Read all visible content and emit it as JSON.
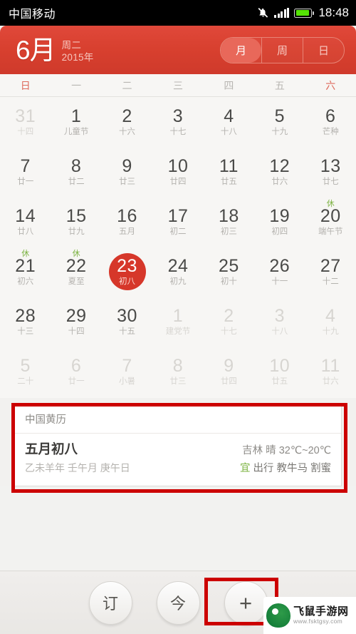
{
  "statusbar": {
    "carrier": "中国移动",
    "mute_icon": "mute-bell-icon",
    "signal_icon": "signal-bars-icon",
    "battery_icon": "battery-icon",
    "clock": "18:48"
  },
  "header": {
    "month": "6月",
    "weekday": "周二",
    "year": "2015年",
    "accent": "#d8402f",
    "segments": [
      {
        "label": "月",
        "selected": true
      },
      {
        "label": "周",
        "selected": false
      },
      {
        "label": "日",
        "selected": false
      }
    ]
  },
  "weekdays": [
    {
      "label": "日",
      "weekend": true
    },
    {
      "label": "一",
      "weekend": false
    },
    {
      "label": "二",
      "weekend": false
    },
    {
      "label": "三",
      "weekend": false
    },
    {
      "label": "四",
      "weekend": false
    },
    {
      "label": "五",
      "weekend": false
    },
    {
      "label": "六",
      "weekend": true
    }
  ],
  "calendar": {
    "today_color": "#d6372a",
    "rest_badge_color": "#7cb342",
    "rows": [
      [
        {
          "day": "31",
          "lunar": "十四",
          "dim": true,
          "badge": "",
          "today": false
        },
        {
          "day": "1",
          "lunar": "儿童节",
          "dim": false,
          "badge": "",
          "today": false
        },
        {
          "day": "2",
          "lunar": "十六",
          "dim": false,
          "badge": "",
          "today": false
        },
        {
          "day": "3",
          "lunar": "十七",
          "dim": false,
          "badge": "",
          "today": false
        },
        {
          "day": "4",
          "lunar": "十八",
          "dim": false,
          "badge": "",
          "today": false
        },
        {
          "day": "5",
          "lunar": "十九",
          "dim": false,
          "badge": "",
          "today": false
        },
        {
          "day": "6",
          "lunar": "芒种",
          "dim": false,
          "badge": "",
          "today": false
        }
      ],
      [
        {
          "day": "7",
          "lunar": "廿一",
          "dim": false,
          "badge": "",
          "today": false
        },
        {
          "day": "8",
          "lunar": "廿二",
          "dim": false,
          "badge": "",
          "today": false
        },
        {
          "day": "9",
          "lunar": "廿三",
          "dim": false,
          "badge": "",
          "today": false
        },
        {
          "day": "10",
          "lunar": "廿四",
          "dim": false,
          "badge": "",
          "today": false
        },
        {
          "day": "11",
          "lunar": "廿五",
          "dim": false,
          "badge": "",
          "today": false
        },
        {
          "day": "12",
          "lunar": "廿六",
          "dim": false,
          "badge": "",
          "today": false
        },
        {
          "day": "13",
          "lunar": "廿七",
          "dim": false,
          "badge": "",
          "today": false
        }
      ],
      [
        {
          "day": "14",
          "lunar": "廿八",
          "dim": false,
          "badge": "",
          "today": false
        },
        {
          "day": "15",
          "lunar": "廿九",
          "dim": false,
          "badge": "",
          "today": false
        },
        {
          "day": "16",
          "lunar": "五月",
          "dim": false,
          "badge": "",
          "today": false
        },
        {
          "day": "17",
          "lunar": "初二",
          "dim": false,
          "badge": "",
          "today": false
        },
        {
          "day": "18",
          "lunar": "初三",
          "dim": false,
          "badge": "",
          "today": false
        },
        {
          "day": "19",
          "lunar": "初四",
          "dim": false,
          "badge": "",
          "today": false
        },
        {
          "day": "20",
          "lunar": "端午节",
          "dim": false,
          "badge": "休",
          "today": false
        }
      ],
      [
        {
          "day": "21",
          "lunar": "初六",
          "dim": false,
          "badge": "休",
          "today": false
        },
        {
          "day": "22",
          "lunar": "夏至",
          "dim": false,
          "badge": "休",
          "today": false
        },
        {
          "day": "23",
          "lunar": "初八",
          "dim": false,
          "badge": "",
          "today": true
        },
        {
          "day": "24",
          "lunar": "初九",
          "dim": false,
          "badge": "",
          "today": false
        },
        {
          "day": "25",
          "lunar": "初十",
          "dim": false,
          "badge": "",
          "today": false
        },
        {
          "day": "26",
          "lunar": "十一",
          "dim": false,
          "badge": "",
          "today": false
        },
        {
          "day": "27",
          "lunar": "十二",
          "dim": false,
          "badge": "",
          "today": false
        }
      ],
      [
        {
          "day": "28",
          "lunar": "十三",
          "dim": false,
          "badge": "",
          "today": false
        },
        {
          "day": "29",
          "lunar": "十四",
          "dim": false,
          "badge": "",
          "today": false
        },
        {
          "day": "30",
          "lunar": "十五",
          "dim": false,
          "badge": "",
          "today": false
        },
        {
          "day": "1",
          "lunar": "建党节",
          "dim": true,
          "badge": "",
          "today": false
        },
        {
          "day": "2",
          "lunar": "十七",
          "dim": true,
          "badge": "",
          "today": false
        },
        {
          "day": "3",
          "lunar": "十八",
          "dim": true,
          "badge": "",
          "today": false
        },
        {
          "day": "4",
          "lunar": "十九",
          "dim": true,
          "badge": "",
          "today": false
        }
      ],
      [
        {
          "day": "5",
          "lunar": "二十",
          "dim": true,
          "badge": "",
          "today": false
        },
        {
          "day": "6",
          "lunar": "廿一",
          "dim": true,
          "badge": "",
          "today": false
        },
        {
          "day": "7",
          "lunar": "小暑",
          "dim": true,
          "badge": "",
          "today": false
        },
        {
          "day": "8",
          "lunar": "廿三",
          "dim": true,
          "badge": "",
          "today": false
        },
        {
          "day": "9",
          "lunar": "廿四",
          "dim": true,
          "badge": "",
          "today": false
        },
        {
          "day": "10",
          "lunar": "廿五",
          "dim": true,
          "badge": "",
          "today": false
        },
        {
          "day": "11",
          "lunar": "廿六",
          "dim": true,
          "badge": "",
          "today": false
        }
      ]
    ]
  },
  "info_card": {
    "title": "中国黄历",
    "lunar_date": "五月初八",
    "ganzhi": "乙未羊年 壬午月 庚午日",
    "weather": "吉林  晴  32℃~20℃",
    "yi_badge": "宜",
    "yi_items": "出行 教牛马 割蜜"
  },
  "bottombar": {
    "buttons": [
      {
        "label": "订",
        "name": "subscribe-button",
        "highlight": false
      },
      {
        "label": "今",
        "name": "today-button",
        "highlight": false
      },
      {
        "label": "+",
        "name": "add-event-button",
        "highlight": true
      }
    ]
  },
  "watermark": {
    "name": "飞鼠手游网",
    "url": "www.fsktgsy.com"
  },
  "annotations": {
    "color": "#cc0000",
    "boxes": [
      "info-card-highlight",
      "add-button-highlight"
    ]
  }
}
